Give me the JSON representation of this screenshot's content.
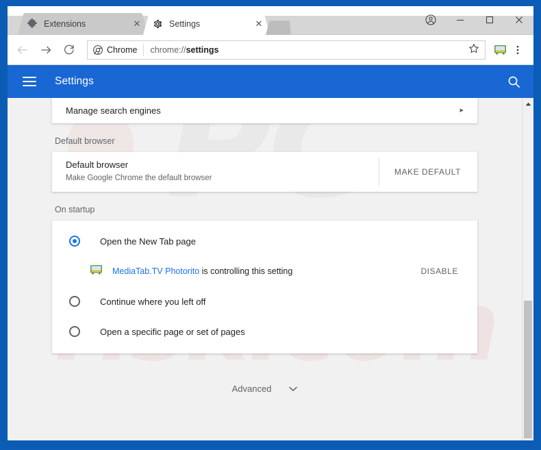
{
  "window": {
    "controls": [
      {
        "name": "profile-avatar",
        "icon": "person-icon",
        "label": ""
      },
      {
        "name": "minimize",
        "icon": "minimize-icon",
        "label": ""
      },
      {
        "name": "maximize",
        "icon": "maximize-icon",
        "label": ""
      },
      {
        "name": "close",
        "icon": "close-icon",
        "label": ""
      }
    ]
  },
  "tabs": [
    {
      "title": "Extensions",
      "favicon": "puzzle-piece-icon",
      "active": false,
      "close_label": "✕"
    },
    {
      "title": "Settings",
      "favicon": "gear-icon",
      "active": true,
      "close_label": "✕"
    }
  ],
  "toolbar": {
    "back_label": "←",
    "forward_label": "→",
    "reload_label": "⟳",
    "chrome_chip_label": "Chrome",
    "url_prefix": "chrome://",
    "url_path": "settings",
    "url_full": "chrome://settings",
    "star_label": "☆",
    "extension_icon_name": "mediatab-tv-extension-icon",
    "menu_label": "⋮"
  },
  "settings_header": {
    "title": "Settings",
    "menu_icon": "hamburger-icon",
    "search_icon": "search-icon"
  },
  "content": {
    "search_engines_row": {
      "label": "Manage search engines",
      "arrow": "▸"
    },
    "default_browser": {
      "section_title": "Default browser",
      "primary": "Default browser",
      "secondary": "Make Google Chrome the default browser",
      "button_label": "MAKE DEFAULT"
    },
    "on_startup": {
      "section_title": "On startup",
      "options": [
        {
          "label": "Open the New Tab page",
          "checked": true
        },
        {
          "label": "Continue where you left off",
          "checked": false
        },
        {
          "label": "Open a specific page or set of pages",
          "checked": false
        }
      ],
      "extension_notice": {
        "icon": "mediatab-tv-extension-icon",
        "link_text": "MediaTab.TV Photorito",
        "suffix_text": " is controlling this setting",
        "disable_label": "DISABLE"
      }
    },
    "advanced": {
      "label": "Advanced",
      "chevron": "▾"
    }
  },
  "scrollbar": {
    "up_label": "▴",
    "down_label": "▾"
  },
  "watermark": {
    "primary": "PC",
    "secondary": "risk.com"
  },
  "colors": {
    "window_border": "#0b5cb5",
    "settings_header": "#1967d2",
    "accent_blue": "#1a73e8",
    "page_bg": "#f1f1f1",
    "card_bg": "#ffffff",
    "text_primary": "#202124",
    "text_secondary": "#5f6368"
  }
}
